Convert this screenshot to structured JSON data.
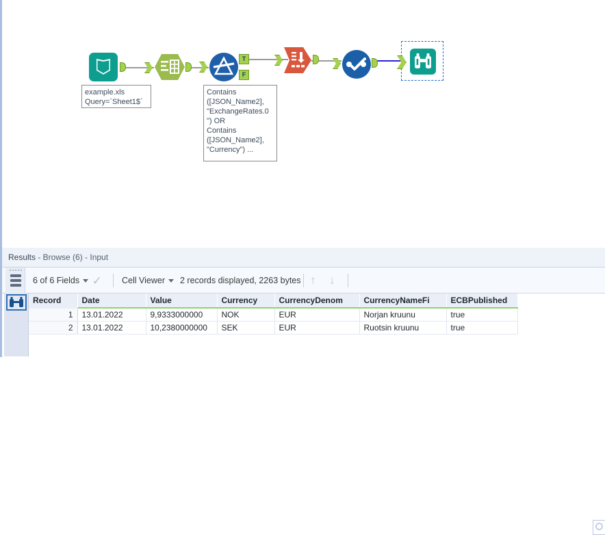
{
  "canvas": {
    "tools": [
      {
        "name": "input-data-tool",
        "label": "Input Data",
        "icon": "book-icon",
        "color": "#0e9e8f"
      },
      {
        "name": "select-tool",
        "label": "Select",
        "icon": "table-fields-icon",
        "color": "#9bbb4f"
      },
      {
        "name": "filter-tool",
        "label": "Filter",
        "icon": "funnel-icon",
        "color": "#1f5fa9"
      },
      {
        "name": "text-to-columns-tool",
        "label": "Text To Columns",
        "icon": "document-arrow-icon",
        "color": "#d9573c"
      },
      {
        "name": "data-cleansing-tool",
        "label": "Data Cleansing",
        "icon": "checkmark-circle-icon",
        "color": "#1b5fa8"
      },
      {
        "name": "browse-tool",
        "label": "Browse",
        "icon": "binoculars-icon",
        "color": "#0e9e8f"
      }
    ],
    "anchors": {
      "true_label": "T",
      "false_label": "F"
    },
    "annotations": [
      {
        "name": "input-annotation",
        "lines": [
          "example.xls",
          "Query=`Sheet1$`"
        ]
      },
      {
        "name": "filter-annotation",
        "lines": [
          "Contains",
          "([JSON_Name2],",
          "\"ExchangeRates.0",
          "\") OR",
          "Contains",
          "([JSON_Name2],",
          "\"Currency\") ..."
        ]
      }
    ]
  },
  "results": {
    "title_prefix": "Results",
    "title_rest": " - Browse (6) - Input",
    "toolbar": {
      "fields_label": "6 of 6 Fields",
      "check_glyph": "✓",
      "viewer_label": "Cell Viewer",
      "records_label": "2 records displayed, 2263 bytes",
      "up_glyph": "↑",
      "down_glyph": "↓"
    },
    "search": {
      "placeholder": ""
    },
    "grid": {
      "columns": [
        "Record",
        "Date",
        "Value",
        "Currency",
        "CurrencyDenom",
        "CurrencyNameFi",
        "ECBPublished"
      ],
      "rows": [
        {
          "record": "1",
          "cells": [
            "13.01.2022",
            "9,9333000000",
            "NOK",
            "EUR",
            "Norjan kruunu",
            "true"
          ]
        },
        {
          "record": "2",
          "cells": [
            "13.01.2022",
            "10,2380000000",
            "SEK",
            "EUR",
            "Ruotsin kruunu",
            "true"
          ]
        }
      ]
    }
  }
}
